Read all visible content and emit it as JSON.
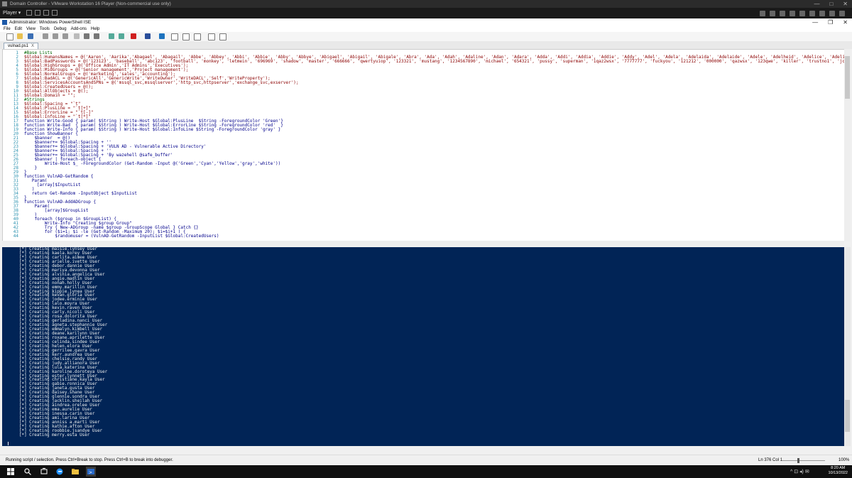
{
  "vmware": {
    "title": "Domain Controller - VMware Workstation 16 Player (Non-commercial use only)",
    "player_menu": "Player",
    "win_min": "—",
    "win_max": "□",
    "win_close": "✕"
  },
  "ise": {
    "title": "Administrator: Windows PowerShell ISE",
    "win_min": "—",
    "win_max": "❐",
    "win_close": "✕",
    "menu": [
      "File",
      "Edit",
      "View",
      "Tools",
      "Debug",
      "Add-ons",
      "Help"
    ],
    "tab": "vulnad.ps1",
    "tab_close": "X"
  },
  "editor": {
    "lines": [
      {
        "n": "1",
        "t": "#Base Lists"
      },
      {
        "n": "2",
        "t": "$Global:HumansNames = @('Aaren', 'Aarika','Abagael', 'Abagail', 'Abbe', 'Abbey', 'Abbi', 'Abbie', 'Abby', 'Abbye', 'Abigael', 'Abigail', 'Abigale', 'Abra', 'Ada', 'Adah', 'Adaline', 'Adan', 'Adara', 'Adda', 'Addi', 'Addia', 'Addie', 'Addy', 'Adel', 'Adela', 'Adelaida', 'Adelaide', 'Adele', 'Adelheid', 'Adelice', 'Adelina', 'Adelind', 'Adeline', 'Adella', 'Adelle', 'Adena', 'Adey', 'Adi', 'Adiana', 'Adina', 'Adora', 'Adore', 'Adoree', 'Adorne', 'Adrea', 'Adria', 'Adriaens', 'Adrian', 'Adriana', 'Adriane', 'Adrianna', 'Adrianne', 'Adriena', 'Adrienne', 'Aeriel', 'Aeriela', 'Aeriell'"
      },
      {
        "n": "3",
        "t": "$Global:BadPasswords = @('123123', 'baseball', 'abc123', 'football', 'monkey', 'letmein', '696969', 'shadow', 'master', '666666', 'qwertyuiop', '123321', 'mustang', '1234567890', 'michael', '654321', 'pussy', 'superman', '1qaz2wsx', '7777777', 'fuckyou', '121212', '000000', 'qazwsx', '123qwe', 'killer', 'trustno1', 'jordan', 'jennifer', 'zxcvbnm', 'asdfgh', 'hunter', 'buster', 'soccer', 'harley', 'batman', 'andrew', 'tigger', 'sunshine', 'iloveyou', '2000', 'charlie', 'robert', 'thomas', 'hockey', 'ranger', 'daniel', 'starwars', 'klaster', '112233', 'george', 'computer', 'michelle', 'jessica', 'pepper', '1111', 'zxcvbn', '555555', '11111111', '131313', 'freedom', '777777', 'pass', 'maggie', '159753', 'aaaaaa', 'ginger', 'princess', 'joshua', 'cheese', 'amanda', 'summer', 'love', 'ashley', 'nicole', 'chelsea', 'biteme', 'matthew', 'access', 'yankees', '987654321', 'dallas', 'austin', 'thunder'"
      },
      {
        "n": "4",
        "t": "$Global:HighGroups = @('Office Admin','IT Admins','Executives');"
      },
      {
        "n": "5",
        "t": "$Global:MidGroups = @('Senior management','Project management');"
      },
      {
        "n": "6",
        "t": "$Global:NormalGroups = @('marketing','sales','accounting');"
      },
      {
        "n": "7",
        "t": "$Global:BadACL = @('GenericAll','GenericWrite','WriteOwner','WriteDACL','Self','WriteProperty');"
      },
      {
        "n": "8",
        "t": "$Global:ServicesAccountsAndSPNs = @('mssql_svc,mssqlserver','http_svc,httpserver','exchange_svc,exserver');"
      },
      {
        "n": "9",
        "t": "$Global:CreatedUsers = @();"
      },
      {
        "n": "10",
        "t": "$Global:AllObjects = @();"
      },
      {
        "n": "11",
        "t": "$Global:Domain = \"\";"
      },
      {
        "n": "12",
        "t": "#Strings"
      },
      {
        "n": "13",
        "t": "$Global:Spacing = \"`t\""
      },
      {
        "n": "14",
        "t": "$Global:PlusLine = \"`t[+]\""
      },
      {
        "n": "15",
        "t": "$Global:ErrorLine = \"`t[-]\""
      },
      {
        "n": "16",
        "t": "$Global:InfoLine = \"`t[*]\""
      },
      {
        "n": "17",
        "t": "function Write-Good { param( $String ) Write-Host $Global:PlusLine  $String -ForegroundColor 'Green'}"
      },
      {
        "n": "18",
        "t": "function Write-Bad  { param( $String ) Write-Host $Global:ErrorLine $String -ForegroundColor 'red'  }"
      },
      {
        "n": "19",
        "t": "function Write-Info { param( $String ) Write-Host $Global:InfoLine $String -ForegroundColor 'gray' }"
      },
      {
        "n": "20",
        "t": "function ShowBanner {"
      },
      {
        "n": "21",
        "t": "    $banner  = @()"
      },
      {
        "n": "22",
        "t": "    $banner+= $Global:Spacing + ''"
      },
      {
        "n": "23",
        "t": "    $banner+= $Global:Spacing + 'VULN AD - Vulnerable Active Directory'"
      },
      {
        "n": "24",
        "t": "    $banner+= $Global:Spacing + ''"
      },
      {
        "n": "25",
        "t": "    $banner+= $Global:Spacing + 'By wazehell @safe_buffer'"
      },
      {
        "n": "26",
        "t": "    $banner | foreach-object {"
      },
      {
        "n": "27",
        "t": "        Write-Host $_ -ForegroundColor (Get-Random -Input @('Green','Cyan','Yellow','gray','white'))"
      },
      {
        "n": "28",
        "t": "    }"
      },
      {
        "n": "29",
        "t": "}"
      },
      {
        "n": "30",
        "t": "function VulnAD-GetRandom {"
      },
      {
        "n": "31",
        "t": "   Param("
      },
      {
        "n": "32",
        "t": "     [array]$InputList"
      },
      {
        "n": "33",
        "t": "   )"
      },
      {
        "n": "34",
        "t": "   return Get-Random -InputObject $InputList"
      },
      {
        "n": "35",
        "t": "}"
      },
      {
        "n": "36",
        "t": "function VulnAD-AddADGroup {"
      },
      {
        "n": "37",
        "t": "    Param("
      },
      {
        "n": "38",
        "t": "        [array]$GroupList"
      },
      {
        "n": "39",
        "t": "    )"
      },
      {
        "n": "40",
        "t": "    foreach ($group in $GroupList) {"
      },
      {
        "n": "41",
        "t": "        Write-Info \"Creating $group Group\""
      },
      {
        "n": "42",
        "t": "        Try { New-ADGroup -name $group -GroupScope Global } Catch {}"
      },
      {
        "n": "43",
        "t": "        for ($i=1; $i -le (Get-Random -Maximum 20); $i=$i+1 ) {"
      },
      {
        "n": "44",
        "t": "            $randomuser = (VulnAD-GetRandom -InputList $Global:CreatedUsers)"
      }
    ]
  },
  "console": {
    "lines": [
      "[*] Creating maisie.lynsey User",
      "[*] Creating kaela.korey User",
      "[*] Creating carlita.aimee User",
      "[*] Creating arielle.ivette User",
      "[*] Creating debor.dannie User",
      "[*] Creating mariya.devonna User",
      "[*] Creating alvinia.angelica User",
      "[*] Creating angie.madlin User",
      "[*] Creating nonah.holly User",
      "[*] Creating emmy.marillin User",
      "[*] Creating kippie.lynea User",
      "[*] Creating kevan.gloria User",
      "[*] Creating jodee.erminie User",
      "[*] Creating lalo.moyra User",
      "[*] Creating kevin.raven User",
      "[*] Creating carly.nicoli User",
      "[*] Creating rosa.dolorita User",
      "[*] Creating gerladina.nanci User",
      "[*] Creating agneta.stephannie User",
      "[*] Creating emmalyn.kimbell User",
      "[*] Creating deane.karilynn User",
      "[*] Creating roxane.aprilette User",
      "[*] Creating celinda.sindee User",
      "[*] Creating helen.elora User",
      "[*] Creating gerrilee.gavra User",
      "[*] Creating kerr.aundrea User",
      "[*] Creating chelsie.randy User",
      "[*] Creating judy.allianora User",
      "[*] Creating lula.katerina User",
      "[*] Creating karoline.doroteya User",
      "[*] Creating ester.lynnett User",
      "[*] Creating christiane.kayla User",
      "[*] Creating gabie.ronnica User",
      "[*] Creating janeta.gusta User",
      "[*] Creating daisey.shane User",
      "[*] Creating glennie.sondra User",
      "[*] Creating jacklin.sheilah User",
      "[*] Creating aindrea.orelee User",
      "[*] Creating ema.aurelie User",
      "[*] Creating inessa.carin User",
      "[*] Creating ami.larina User",
      "[*] Creating anniss a.marti User",
      "[*] Creating kathie.afton User",
      "[*] Creating roobbie.jsandye User",
      "[*] Creating merry.esta User"
    ]
  },
  "status": {
    "message": "Running script / selection.  Press Ctrl+Break to stop.  Press Ctrl+B to break into debugger.",
    "position": "Ln 376  Col 1",
    "zoom": "100%"
  },
  "taskbar": {
    "time": "8:20 AM",
    "date": "10/13/2022",
    "tray_icons": "^ ⊡ ◂) ✉"
  },
  "colors": {
    "console_bg": "#012456",
    "editor_bg": "#ffffff",
    "vm_chrome": "#1a1a1a"
  }
}
